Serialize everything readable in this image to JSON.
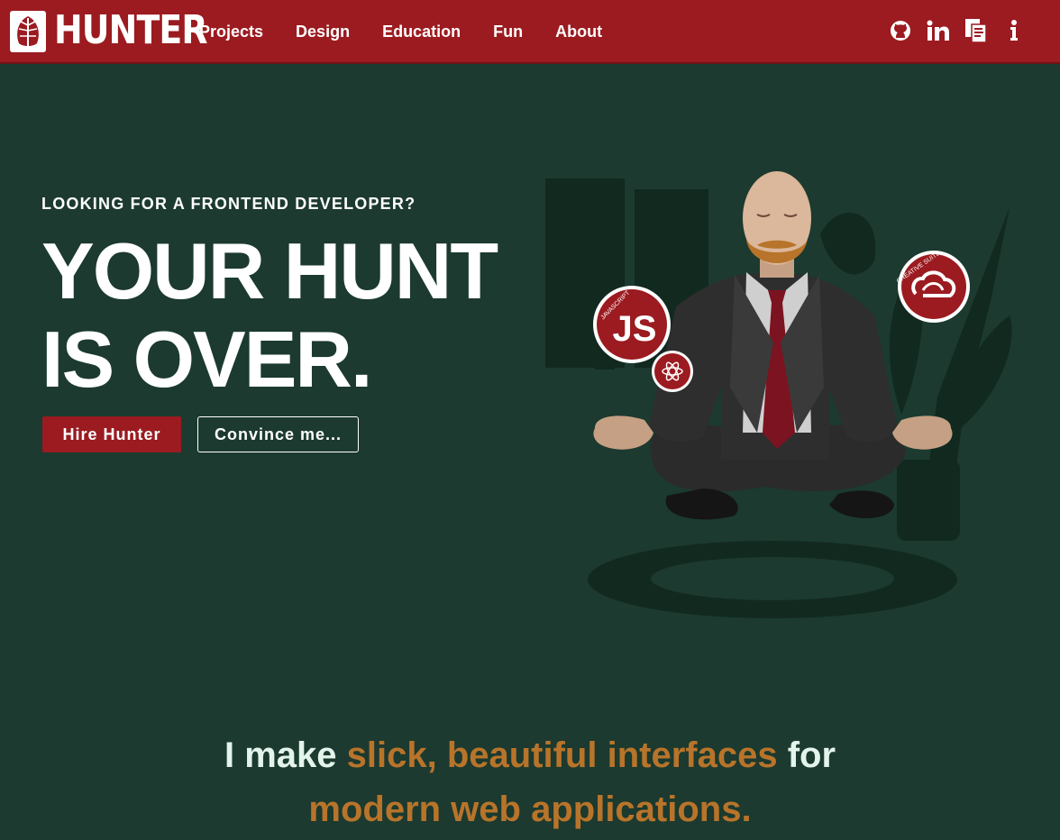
{
  "brand": {
    "name": "HUNTER",
    "logo_icon": "leaf-icon"
  },
  "nav": {
    "links": [
      {
        "label": "Projects"
      },
      {
        "label": "Design"
      },
      {
        "label": "Education"
      },
      {
        "label": "Fun"
      },
      {
        "label": "About"
      }
    ],
    "icons": [
      "github-icon",
      "linkedin-icon",
      "resume-icon",
      "info-icon"
    ]
  },
  "hero": {
    "eyebrow": "LOOKING FOR A FRONTEND DEVELOPER?",
    "headline_line1": "YOUR HUNT",
    "headline_line2": "IS OVER.",
    "primary_button": "Hire Hunter",
    "secondary_button": "Convince me...",
    "badges": {
      "js_text": "JS",
      "js_caption": "JAVASCRIPT",
      "creative_suite_caption": "CREATIVE SUITE"
    }
  },
  "tagline": {
    "part1": "I make ",
    "part2": "slick, beautiful interfaces",
    "part3": " for",
    "part4": "modern web applications."
  },
  "colors": {
    "background": "#1c3a2f",
    "nav": "#9b1b20",
    "accent": "#b8742a",
    "text_light": "#e3f4ec"
  }
}
